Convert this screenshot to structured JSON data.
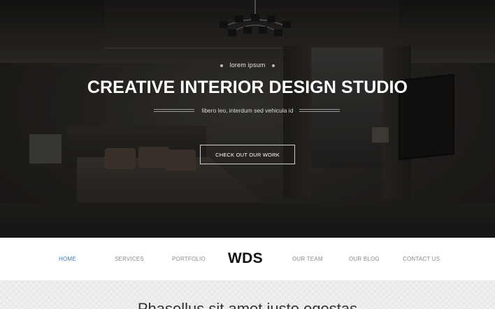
{
  "hero": {
    "eyebrow": "lorem ipsum",
    "title": "CREATIVE INTERIOR DESIGN STUDIO",
    "subtitle": "libero leo, interdum sed vehicula id",
    "cta_label": "CHECK OUT OUR WORK"
  },
  "nav": {
    "logo": "WDS",
    "items": [
      {
        "label": "HOME",
        "active": true
      },
      {
        "label": "SERVICES",
        "active": false
      },
      {
        "label": "PORTFOLIO",
        "active": false
      },
      {
        "label": "OUR TEAM",
        "active": false
      },
      {
        "label": "OUR BLOG",
        "active": false
      },
      {
        "label": "CONTACT US",
        "active": false
      }
    ]
  },
  "content": {
    "heading": "Phasellus sit amet justo egestas"
  },
  "colors": {
    "active_nav": "#3d7ab8",
    "nav_text": "#8a8a8a",
    "hero_text": "#ffffff",
    "content_bg": "#eef0f2"
  }
}
